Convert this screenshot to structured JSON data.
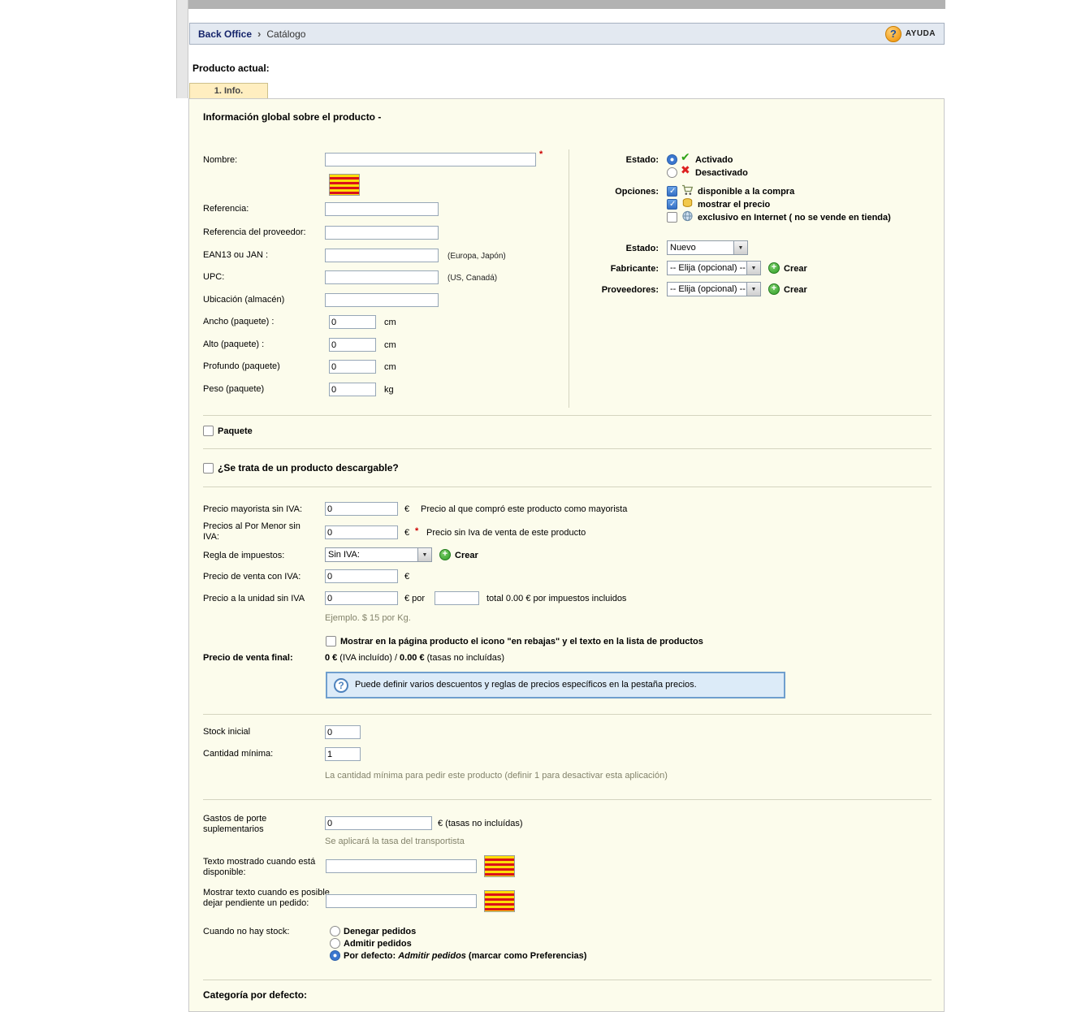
{
  "icons": {
    "breadcrumb_sep": "›",
    "help_q": "?",
    "check": "✔",
    "cross": "✖",
    "dropdown": "▼",
    "plus": "+",
    "question": "?"
  },
  "breadcrumb": {
    "root": "Back Office",
    "section": "Catálogo",
    "help": "AYUDA"
  },
  "header": {
    "current_product": "Producto actual:",
    "tab": "1. Info."
  },
  "panel": {
    "title": "Información global sobre el producto -"
  },
  "general": {
    "nombre": {
      "label": "Nombre:",
      "value": "",
      "required": "*"
    },
    "referencia": {
      "label": "Referencia:",
      "value": ""
    },
    "ref_proveedor": {
      "label": "Referencia del proveedor:",
      "value": ""
    },
    "ean": {
      "label": "EAN13 ou JAN :",
      "value": "",
      "hint": "(Europa, Japón)"
    },
    "upc": {
      "label": "UPC:",
      "value": "",
      "hint": "(US, Canadá)"
    },
    "ubicacion": {
      "label": "Ubicación (almacén)",
      "value": ""
    },
    "ancho": {
      "label": "Ancho (paquete) :",
      "value": "0",
      "unit": "cm"
    },
    "alto": {
      "label": "Alto (paquete) :",
      "value": "0",
      "unit": "cm"
    },
    "profundo": {
      "label": "Profundo (paquete)",
      "value": "0",
      "unit": "cm"
    },
    "peso": {
      "label": "Peso (paquete)",
      "value": "0",
      "unit": "kg"
    }
  },
  "estado": {
    "label": "Estado:",
    "activado": "Activado",
    "desactivado": "Desactivado"
  },
  "opciones": {
    "label": "Opciones:",
    "disponible": "disponible a la compra",
    "mostrar_precio": "mostrar el precio",
    "exclusivo": "exclusivo en Internet ( no se vende en tienda)"
  },
  "condicion": {
    "label": "Estado:",
    "value": "Nuevo"
  },
  "fabricante": {
    "label": "Fabricante:",
    "value": "-- Elija (opcional) --",
    "crear": "Crear"
  },
  "proveedores": {
    "label": "Proveedores:",
    "value": "-- Elija (opcional) --",
    "crear": "Crear"
  },
  "paquete": {
    "label": "Paquete"
  },
  "descargable": {
    "label": "¿Se trata de un producto descargable?"
  },
  "precios": {
    "mayorista": {
      "label": "Precio mayorista sin IVA:",
      "value": "0",
      "unit": "€",
      "hint": "Precio al que compró este producto como mayorista"
    },
    "menor": {
      "label": "Precios al Por Menor sin IVA:",
      "value": "0",
      "unit": "€",
      "required": "*",
      "hint": "Precio sin Iva de venta de este producto"
    },
    "impuestos": {
      "label": "Regla de impuestos:",
      "value": "Sin IVA:",
      "crear": "Crear"
    },
    "venta_iva": {
      "label": "Precio de venta con IVA:",
      "value": "0",
      "unit": "€"
    },
    "unidad": {
      "label": "Precio a la unidad sin IVA",
      "value": "0",
      "unit": "€ por",
      "por_valor": "",
      "total": "total 0.00 € por impuestos incluidos"
    },
    "ejemplo": "Ejemplo. $ 15 por Kg.",
    "rebajas": "Mostrar en la página producto el icono \"en rebajas\" y el texto en la lista de productos",
    "final": {
      "label": "Precio de venta final:",
      "iva_incl": "0 €",
      "iva_incl_nota": "(IVA incluído) /",
      "sin_tasas": "0.00 €",
      "sin_tasas_nota": "(tasas no incluídas)"
    },
    "nota": "Puede definir varios descuentos y reglas de precios específicos en la pestaña precios."
  },
  "stock": {
    "inicial": {
      "label": "Stock inicial",
      "value": "0"
    },
    "minima": {
      "label": "Cantidad mínima:",
      "value": "1",
      "hint": "La cantidad mínima para pedir este producto (definir 1 para desactivar esta aplicación)"
    }
  },
  "envio": {
    "gastos": {
      "label": "Gastos de porte suplementarios",
      "value": "0",
      "unit": "€ (tasas no incluídas)",
      "hint": "Se aplicará la tasa del transportista"
    },
    "texto_disponible": {
      "label": "Texto mostrado cuando está disponible:",
      "value": ""
    },
    "texto_pendiente": {
      "label": "Mostrar texto cuando es posible dejar pendiente un pedido:",
      "value": ""
    },
    "sin_stock": {
      "label": "Cuando no hay stock:",
      "denegar": "Denegar pedidos",
      "admitir": "Admitir pedidos",
      "defecto_prefix": "Por defecto:",
      "defecto_valor": "Admitir pedidos",
      "defecto_sufijo": "(marcar como Preferencias)"
    }
  },
  "categoria": {
    "label": "Categoría por defecto:"
  }
}
